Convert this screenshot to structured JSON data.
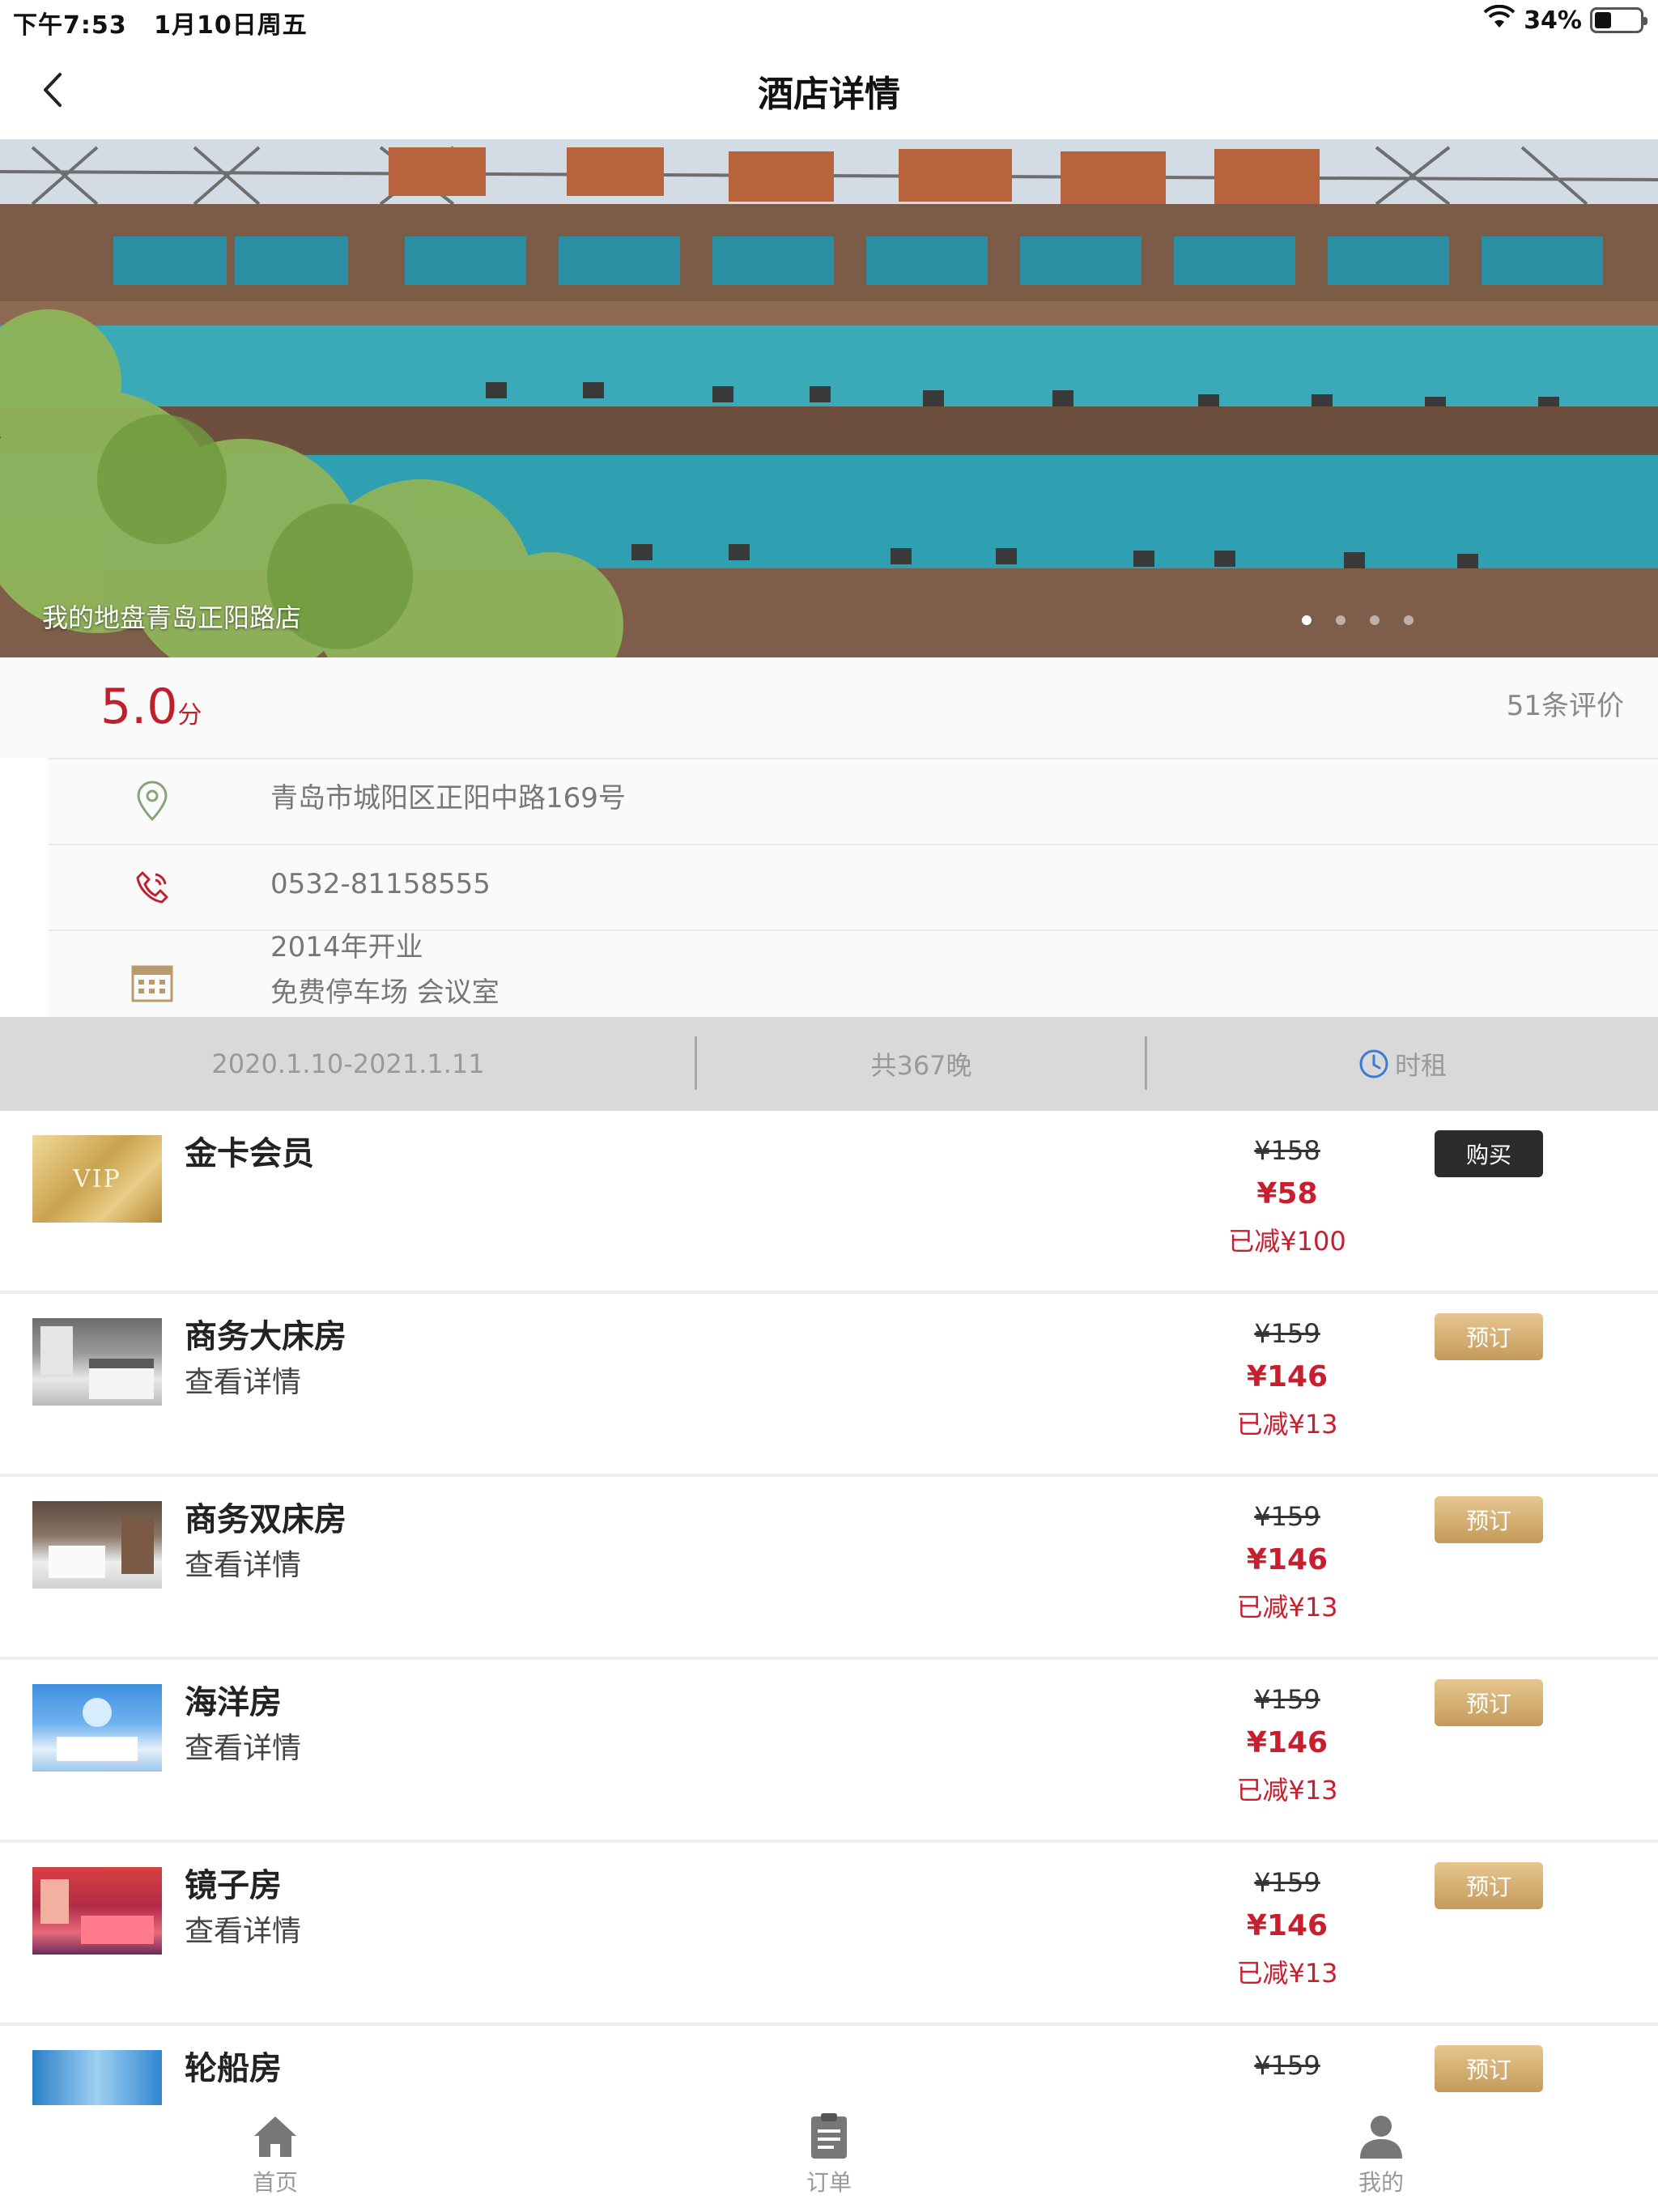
{
  "status_bar": {
    "time": "下午7:53",
    "date": "1月10日周五",
    "battery": "34%"
  },
  "nav": {
    "title": "酒店详情",
    "back_icon": "chevron-left-icon"
  },
  "hero": {
    "caption": "我的地盘青岛正阳路店",
    "dots_count": 4,
    "active_dot": 1
  },
  "rating": {
    "score": "5.0",
    "unit": "分",
    "reviews": "51条评价"
  },
  "info": {
    "address": "青岛市城阳区正阳中路169号",
    "phone": "0532-81158555",
    "opened": "2014年开业",
    "facilities": "免费停车场 会议室"
  },
  "date_bar": {
    "range": "2020.1.10-2021.1.11",
    "nights": "共367晚",
    "hourly": "时租"
  },
  "rooms": [
    {
      "name": "金卡会员",
      "detail": "",
      "orig_price": "¥158",
      "price": "¥58",
      "saved": "已减¥100",
      "button": "购买",
      "thumb": "vip"
    },
    {
      "name": "商务大床房",
      "detail": "查看详情",
      "orig_price": "¥159",
      "price": "¥146",
      "saved": "已减¥13",
      "button": "预订",
      "thumb": "room1"
    },
    {
      "name": "商务双床房",
      "detail": "查看详情",
      "orig_price": "¥159",
      "price": "¥146",
      "saved": "已减¥13",
      "button": "预订",
      "thumb": "room2"
    },
    {
      "name": "海洋房",
      "detail": "查看详情",
      "orig_price": "¥159",
      "price": "¥146",
      "saved": "已减¥13",
      "button": "预订",
      "thumb": "ocean"
    },
    {
      "name": "镜子房",
      "detail": "查看详情",
      "orig_price": "¥159",
      "price": "¥146",
      "saved": "已减¥13",
      "button": "预订",
      "thumb": "mirror"
    },
    {
      "name": "轮船房",
      "detail": "",
      "orig_price": "¥159",
      "price": "",
      "saved": "",
      "button": "预订",
      "thumb": "ship"
    }
  ],
  "vip_card_text": "VIP",
  "tabs": [
    {
      "label": "首页",
      "icon": "home-icon"
    },
    {
      "label": "订单",
      "icon": "clipboard-icon"
    },
    {
      "label": "我的",
      "icon": "user-icon"
    }
  ],
  "colors": {
    "price_red": "#c81e2e",
    "gold_button": "#c49a5a",
    "dark_button": "#2b2b2b"
  }
}
